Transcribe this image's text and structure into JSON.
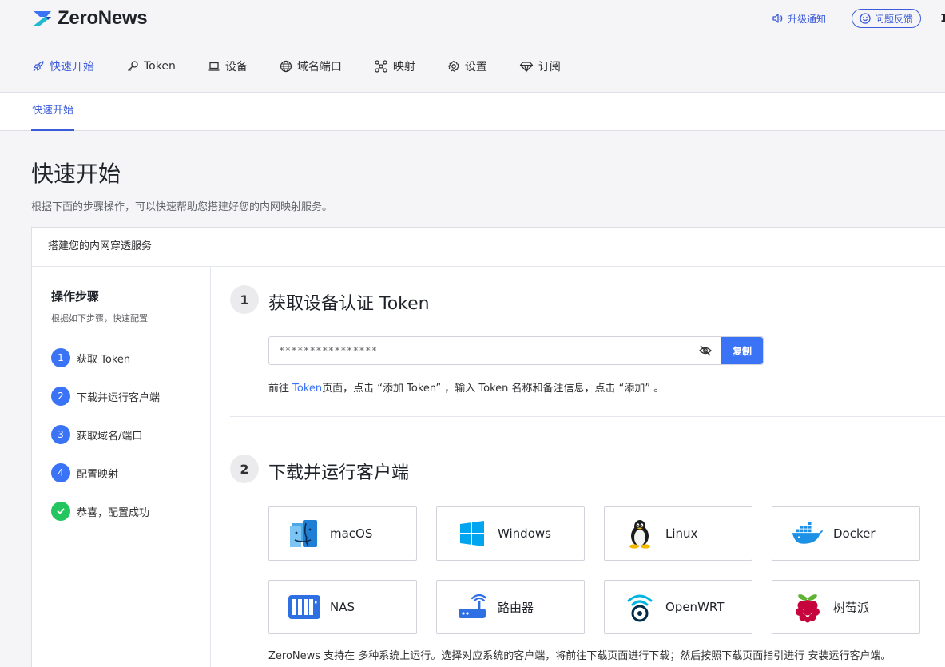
{
  "brand": {
    "name": "ZeroNews"
  },
  "header": {
    "upgrade_label": "升级通知",
    "feedback_label": "问题反馈",
    "cut_text": "1"
  },
  "nav": [
    {
      "label": "快速开始",
      "icon": "rocket-icon",
      "active": true
    },
    {
      "label": "Token",
      "icon": "key-icon"
    },
    {
      "label": "设备",
      "icon": "laptop-icon"
    },
    {
      "label": "域名端口",
      "icon": "globe-icon"
    },
    {
      "label": "映射",
      "icon": "network-icon"
    },
    {
      "label": "设置",
      "icon": "gear-icon"
    },
    {
      "label": "订阅",
      "icon": "diamond-icon"
    }
  ],
  "tab": {
    "label": "快速开始"
  },
  "page": {
    "title": "快速开始",
    "subtitle": "根据下面的步骤操作，可以快速帮助您搭建好您的内网映射服务。"
  },
  "card": {
    "title": "搭建您的内网穿透服务"
  },
  "steps": {
    "title": "操作步骤",
    "subtitle": "根据如下步骤，快速配置",
    "items": [
      {
        "num": "1",
        "label": "获取 Token"
      },
      {
        "num": "2",
        "label": "下载并运行客户端"
      },
      {
        "num": "3",
        "label": "获取域名/端口"
      },
      {
        "num": "4",
        "label": "配置映射"
      },
      {
        "num": "",
        "label": "恭喜，配置成功"
      }
    ]
  },
  "section1": {
    "num": "1",
    "title": "获取设备认证 Token",
    "token_value": "****************",
    "copy_label": "复制",
    "hint_prefix": "前往 ",
    "hint_link": "Token",
    "hint_suffix": "页面，点击 “添加 Token” ，输入 Token 名称和备注信息，点击 “添加” 。"
  },
  "section2": {
    "num": "2",
    "title": "下载并运行客户端",
    "clients": [
      {
        "label": "macOS",
        "icon": "macos-finder-icon"
      },
      {
        "label": "Windows",
        "icon": "windows-icon"
      },
      {
        "label": "Linux",
        "icon": "linux-tux-icon"
      },
      {
        "label": "Docker",
        "icon": "docker-icon"
      },
      {
        "label": "NAS",
        "icon": "nas-icon"
      },
      {
        "label": "路由器",
        "icon": "router-icon"
      },
      {
        "label": "OpenWRT",
        "icon": "openwrt-icon"
      },
      {
        "label": "树莓派",
        "icon": "raspberry-pi-icon"
      }
    ],
    "footer": "ZeroNews 支持在 多种系统上运行。选择对应系统的客户端，将前往下载页面进行下载；然后按照下载页面指引进行 安装运行客户端。"
  },
  "colors": {
    "accent": "#3b73f6",
    "nav_active": "#3b5bdb",
    "success": "#22c55e"
  }
}
